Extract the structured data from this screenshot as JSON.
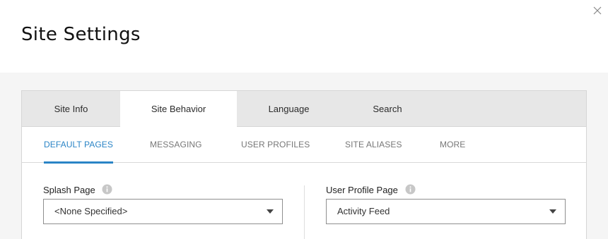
{
  "dialog": {
    "title": "Site Settings",
    "close_icon": "close-icon"
  },
  "tabs": [
    {
      "label": "Site Info",
      "active": false
    },
    {
      "label": "Site Behavior",
      "active": true
    },
    {
      "label": "Language",
      "active": false
    },
    {
      "label": "Search",
      "active": false
    }
  ],
  "subtabs": [
    {
      "label": "DEFAULT PAGES",
      "active": true
    },
    {
      "label": "MESSAGING",
      "active": false
    },
    {
      "label": "USER PROFILES",
      "active": false
    },
    {
      "label": "SITE ALIASES",
      "active": false
    },
    {
      "label": "MORE",
      "active": false
    }
  ],
  "fields": {
    "splash_page": {
      "label": "Splash Page",
      "value": "<None Specified>",
      "icon": "info-icon"
    },
    "user_profile_page": {
      "label": "User Profile Page",
      "value": "Activity Feed",
      "icon": "info-icon"
    }
  },
  "colors": {
    "accent": "#2a84c6",
    "tab_bar": "#e7e7e7",
    "backdrop": "#f5f5f5"
  }
}
